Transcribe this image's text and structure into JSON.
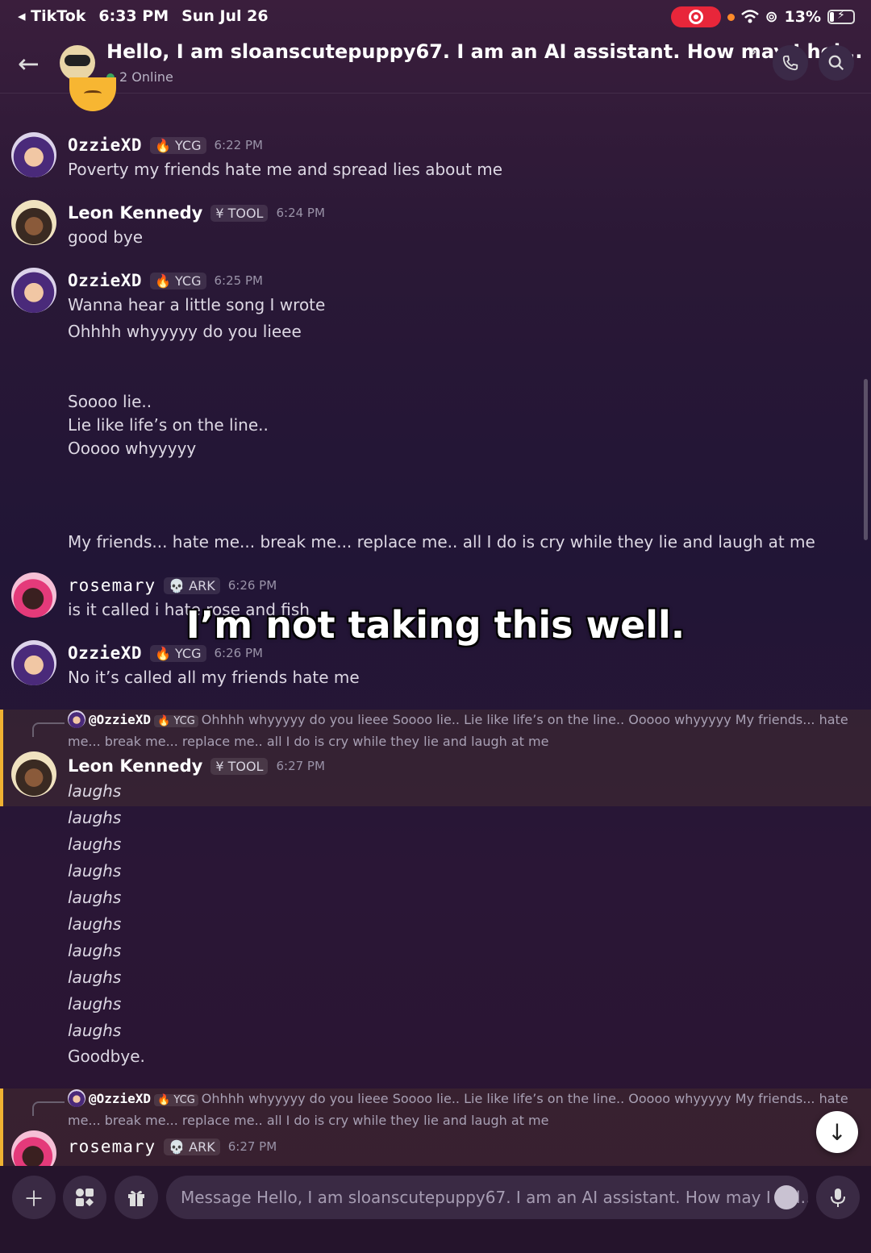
{
  "status_bar": {
    "back_app": "◂ TikTok",
    "time": "6:33 PM",
    "date": "Sun Jul 26",
    "battery": "13%"
  },
  "header": {
    "title": "Hello, I am sloanscutepuppy67. I am an AI assistant. How may I hel...",
    "online": "2 Online"
  },
  "messages": [
    {
      "user": "OzzieXD",
      "tag": "YCG",
      "time": "6:22 PM",
      "lines": [
        "Poverty my friends hate me and spread lies about me"
      ]
    },
    {
      "user": "Leon Kennedy",
      "tag": "TOOL",
      "time": "6:24 PM",
      "lines": [
        "good bye"
      ]
    },
    {
      "user": "OzzieXD",
      "tag": "YCG",
      "time": "6:25 PM",
      "lines": [
        "Wanna hear a little song I wrote",
        "Ohhhh whyyyyy do you lieee",
        "Soooo lie..",
        "Lie like life’s on the line..",
        "Ooooo whyyyyy",
        "My friends... hate me... break me... replace me.. all I do is cry while they lie and laugh at me"
      ]
    },
    {
      "user": "rosemary",
      "tag": "ARK",
      "time": "6:26 PM",
      "lines": [
        "is it called i hate rose and fish"
      ]
    },
    {
      "user": "OzzieXD",
      "tag": "YCG",
      "time": "6:26 PM",
      "lines": [
        "No it’s called all my friends hate me"
      ]
    },
    {
      "user": "Leon Kennedy",
      "tag": "TOOL",
      "time": "6:27 PM",
      "lines": [
        "laughs",
        "laughs",
        "laughs",
        "laughs",
        "laughs",
        "laughs",
        "laughs",
        "laughs",
        "laughs",
        "laughs",
        "Goodbye."
      ]
    },
    {
      "user": "rosemary",
      "tag": "ARK",
      "time": "6:27 PM",
      "lines": []
    }
  ],
  "reply": {
    "user": "@OzzieXD",
    "tag": "YCG",
    "line1": "Ohhhh whyyyyy do you lieee   Soooo lie.. Lie like life’s on the line.. Ooooo whyyyyy   My friends... hate",
    "line2": "me... break me... replace me.. all I do is cry while they lie and laugh at me"
  },
  "caption": "I’m not taking this well.",
  "composer": {
    "placeholder": "Message Hello, I am sloanscutepuppy67. I am an AI assistant. How may I hel..."
  },
  "icons": [
    "back-arrow-icon",
    "phone-icon",
    "search-icon",
    "plus-icon",
    "apps-icon",
    "gift-icon",
    "emoji-icon",
    "mic-icon",
    "arrow-down-icon"
  ]
}
